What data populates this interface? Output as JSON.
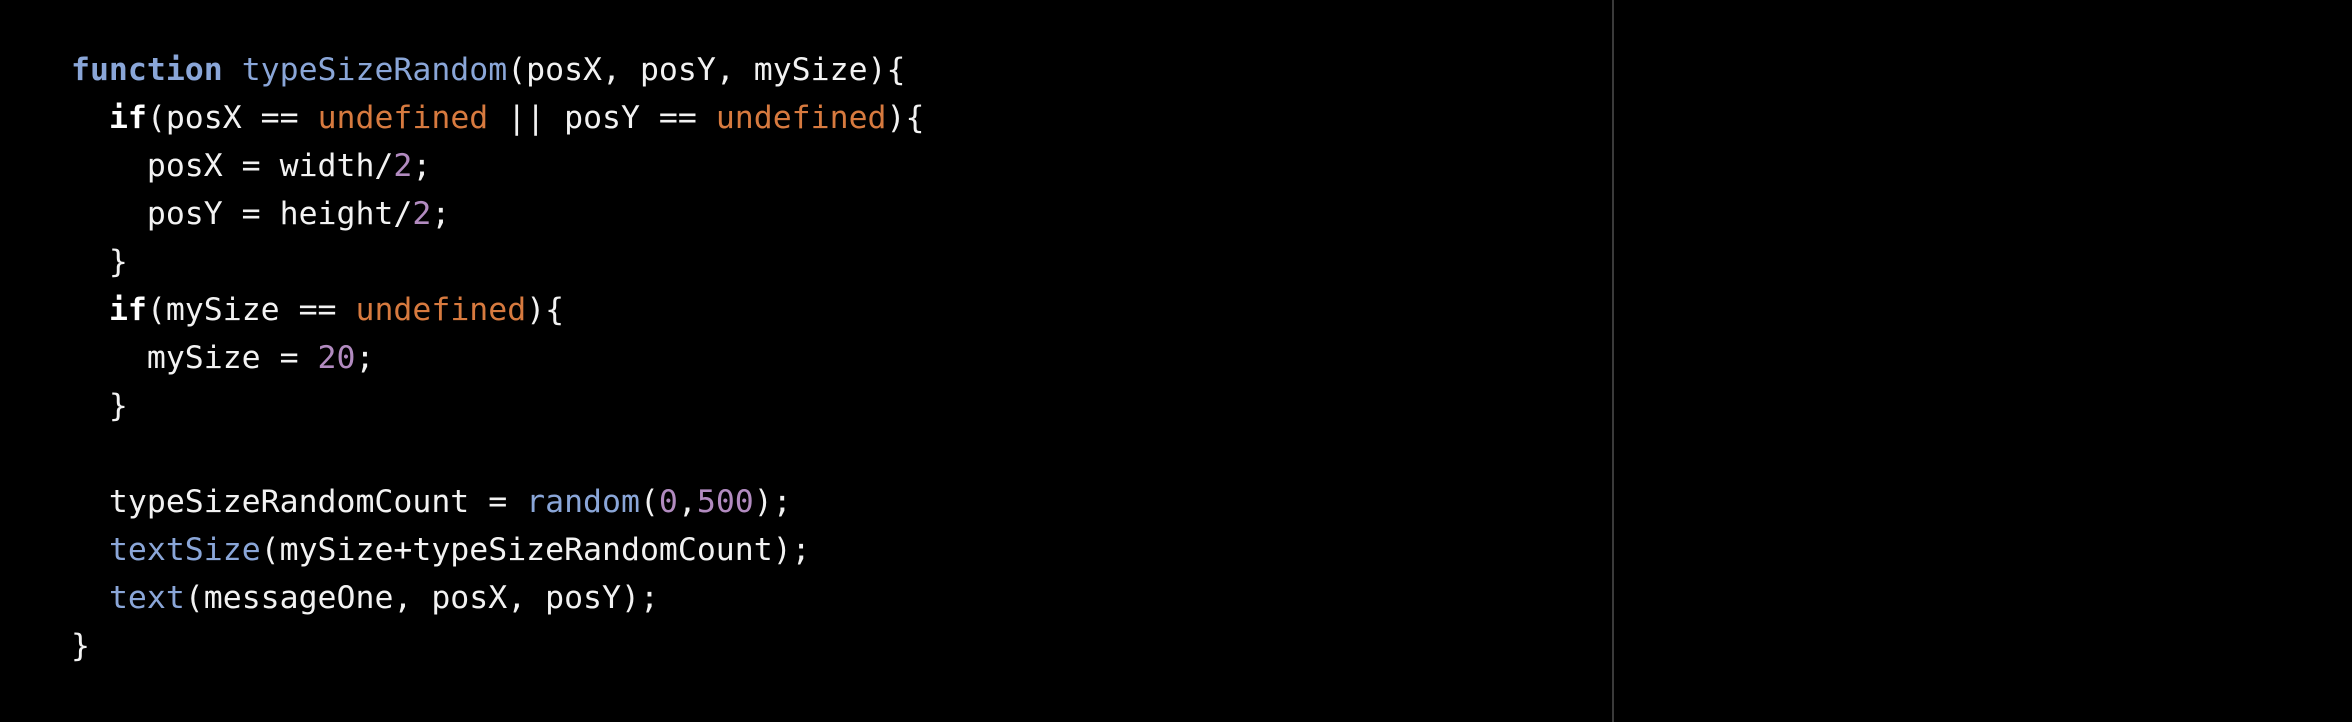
{
  "colors": {
    "background": "#000000",
    "text": "#f2f2f2",
    "keyword": "#8aa6d8",
    "function_call": "#8aa6d8",
    "undefined": "#d77a3f",
    "number": "#b28bc0",
    "divider": "#3a3a3a"
  },
  "code_lines": [
    [
      {
        "t": "function",
        "c": "kw"
      },
      {
        "t": " ",
        "c": ""
      },
      {
        "t": "typeSizeRandom",
        "c": "fn"
      },
      {
        "t": "(posX, posY, mySize){",
        "c": ""
      }
    ],
    [
      {
        "t": "  ",
        "c": ""
      },
      {
        "t": "if",
        "c": "ctl"
      },
      {
        "t": "(posX == ",
        "c": ""
      },
      {
        "t": "undefined",
        "c": "undef"
      },
      {
        "t": " || posY == ",
        "c": ""
      },
      {
        "t": "undefined",
        "c": "undef"
      },
      {
        "t": "){",
        "c": ""
      }
    ],
    [
      {
        "t": "    posX = width/",
        "c": ""
      },
      {
        "t": "2",
        "c": "num"
      },
      {
        "t": ";",
        "c": ""
      }
    ],
    [
      {
        "t": "    posY = height/",
        "c": ""
      },
      {
        "t": "2",
        "c": "num"
      },
      {
        "t": ";",
        "c": ""
      }
    ],
    [
      {
        "t": "  }",
        "c": ""
      }
    ],
    [
      {
        "t": "  ",
        "c": ""
      },
      {
        "t": "if",
        "c": "ctl"
      },
      {
        "t": "(mySize == ",
        "c": ""
      },
      {
        "t": "undefined",
        "c": "undef"
      },
      {
        "t": "){",
        "c": ""
      }
    ],
    [
      {
        "t": "    mySize = ",
        "c": ""
      },
      {
        "t": "20",
        "c": "num"
      },
      {
        "t": ";",
        "c": ""
      }
    ],
    [
      {
        "t": "  }",
        "c": ""
      }
    ],
    [
      {
        "t": "",
        "c": ""
      }
    ],
    [
      {
        "t": "  typeSizeRandomCount = ",
        "c": ""
      },
      {
        "t": "random",
        "c": "fn"
      },
      {
        "t": "(",
        "c": ""
      },
      {
        "t": "0",
        "c": "num"
      },
      {
        "t": ",",
        "c": ""
      },
      {
        "t": "500",
        "c": "num"
      },
      {
        "t": ");",
        "c": ""
      }
    ],
    [
      {
        "t": "  ",
        "c": ""
      },
      {
        "t": "textSize",
        "c": "fn"
      },
      {
        "t": "(mySize+typeSizeRandomCount);",
        "c": ""
      }
    ],
    [
      {
        "t": "  ",
        "c": ""
      },
      {
        "t": "text",
        "c": "fn"
      },
      {
        "t": "(messageOne, posX, posY);",
        "c": ""
      }
    ],
    [
      {
        "t": "}",
        "c": ""
      }
    ]
  ]
}
